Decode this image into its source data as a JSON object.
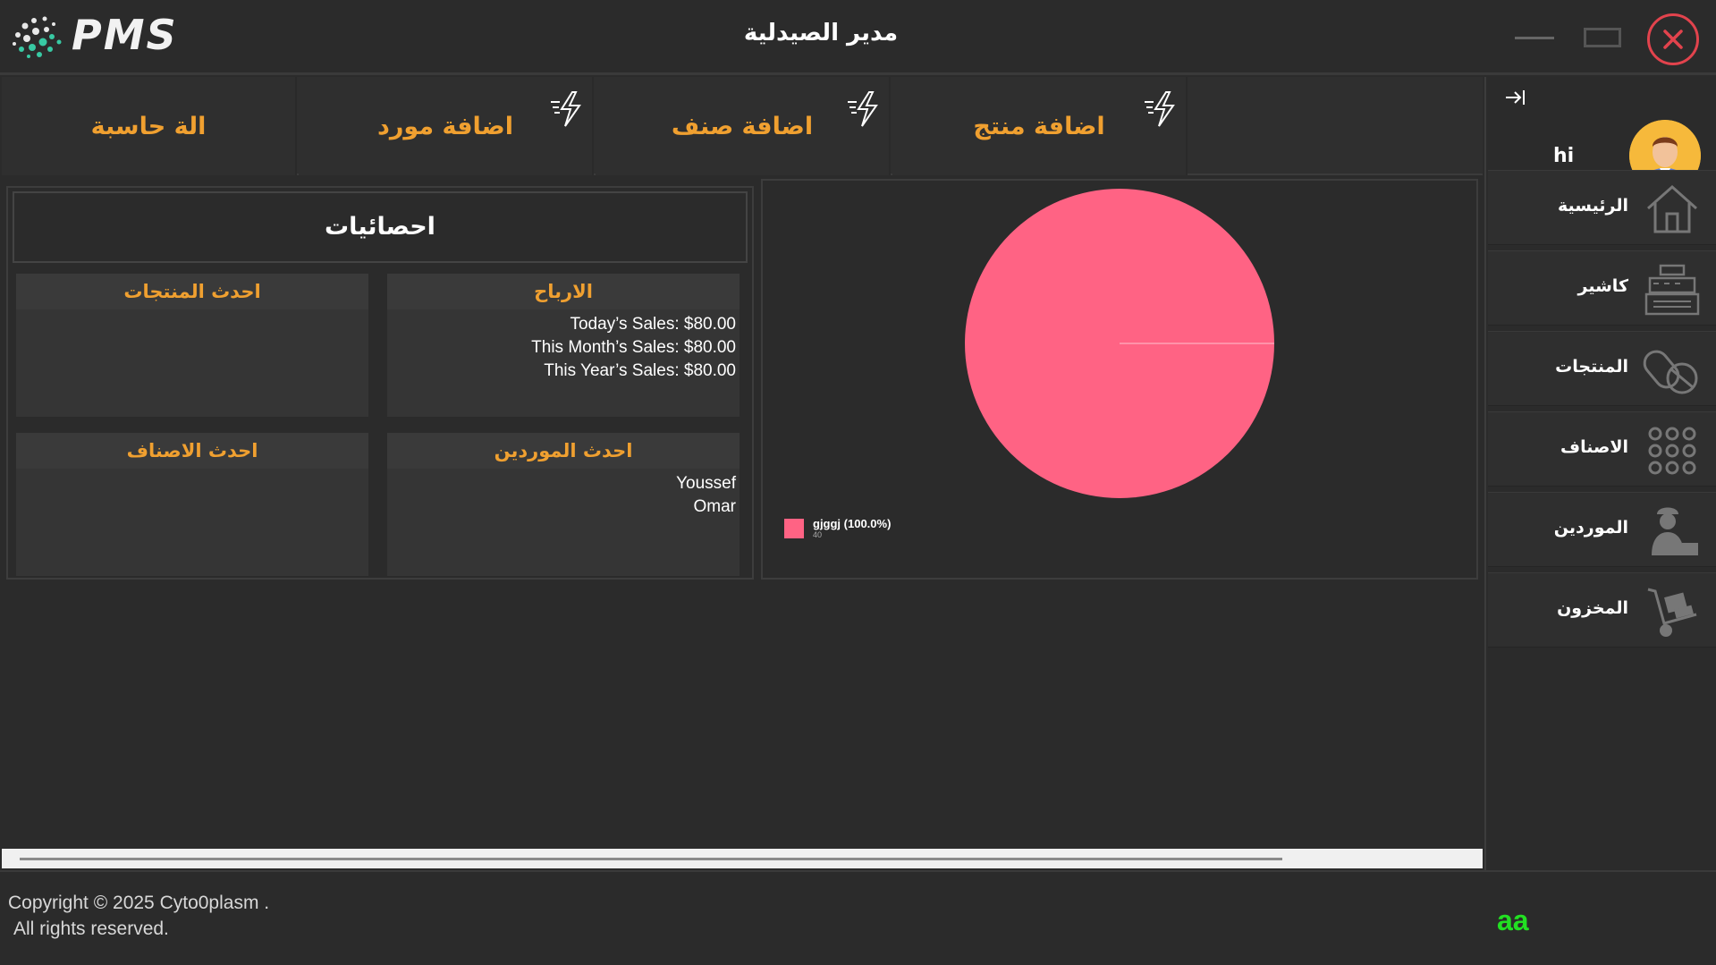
{
  "app": {
    "logo_text": "PMS",
    "title": "مدير الصيدلية"
  },
  "sidebar": {
    "greeting": "hi",
    "items": [
      {
        "label": "الرئيسية",
        "icon": "home-icon"
      },
      {
        "label": "كاشير",
        "icon": "cash-register-icon"
      },
      {
        "label": "المنتجات",
        "icon": "pills-icon"
      },
      {
        "label": "الاصناف",
        "icon": "grid-dots-icon"
      },
      {
        "label": "الموردين",
        "icon": "supplier-icon"
      },
      {
        "label": "المخزون",
        "icon": "hand-truck-icon"
      }
    ]
  },
  "toolbar": {
    "add_product": "اضافة منتج",
    "add_category": "اضافة صنف",
    "add_supplier": "اضافة مورد",
    "calculator": "الة حاسبة"
  },
  "stats": {
    "title": "احصائيات",
    "profits": {
      "title": "الارباح",
      "today": "Today’s Sales: $80.00",
      "month": "This Month’s Sales: $80.00",
      "year": "This Year’s Sales: $80.00"
    },
    "latest_products": {
      "title": "احدث المنتجات"
    },
    "latest_suppliers": {
      "title": "احدث الموردين",
      "items": [
        "Youssef",
        "Omar"
      ]
    },
    "latest_categories": {
      "title": "احدث الاصناف"
    }
  },
  "chart_data": {
    "type": "pie",
    "slices": [
      {
        "label": "gjggj",
        "value": 40,
        "percent": 100.0,
        "color": "#ff6384"
      }
    ],
    "legend_label": "gjggj (100.0%)",
    "legend_value": "40",
    "legend_position": "bottom-left"
  },
  "footer": {
    "copyright_line1": "Copyright © 2025 Cyto0plasm .",
    "copyright_line2": "All rights reserved.",
    "badge": "aa"
  },
  "colors": {
    "background": "#2b2b2b",
    "accent_orange": "#f0a030",
    "close_red": "#e2434d",
    "pie_pink": "#ff6384",
    "badge_green": "#22e022"
  }
}
